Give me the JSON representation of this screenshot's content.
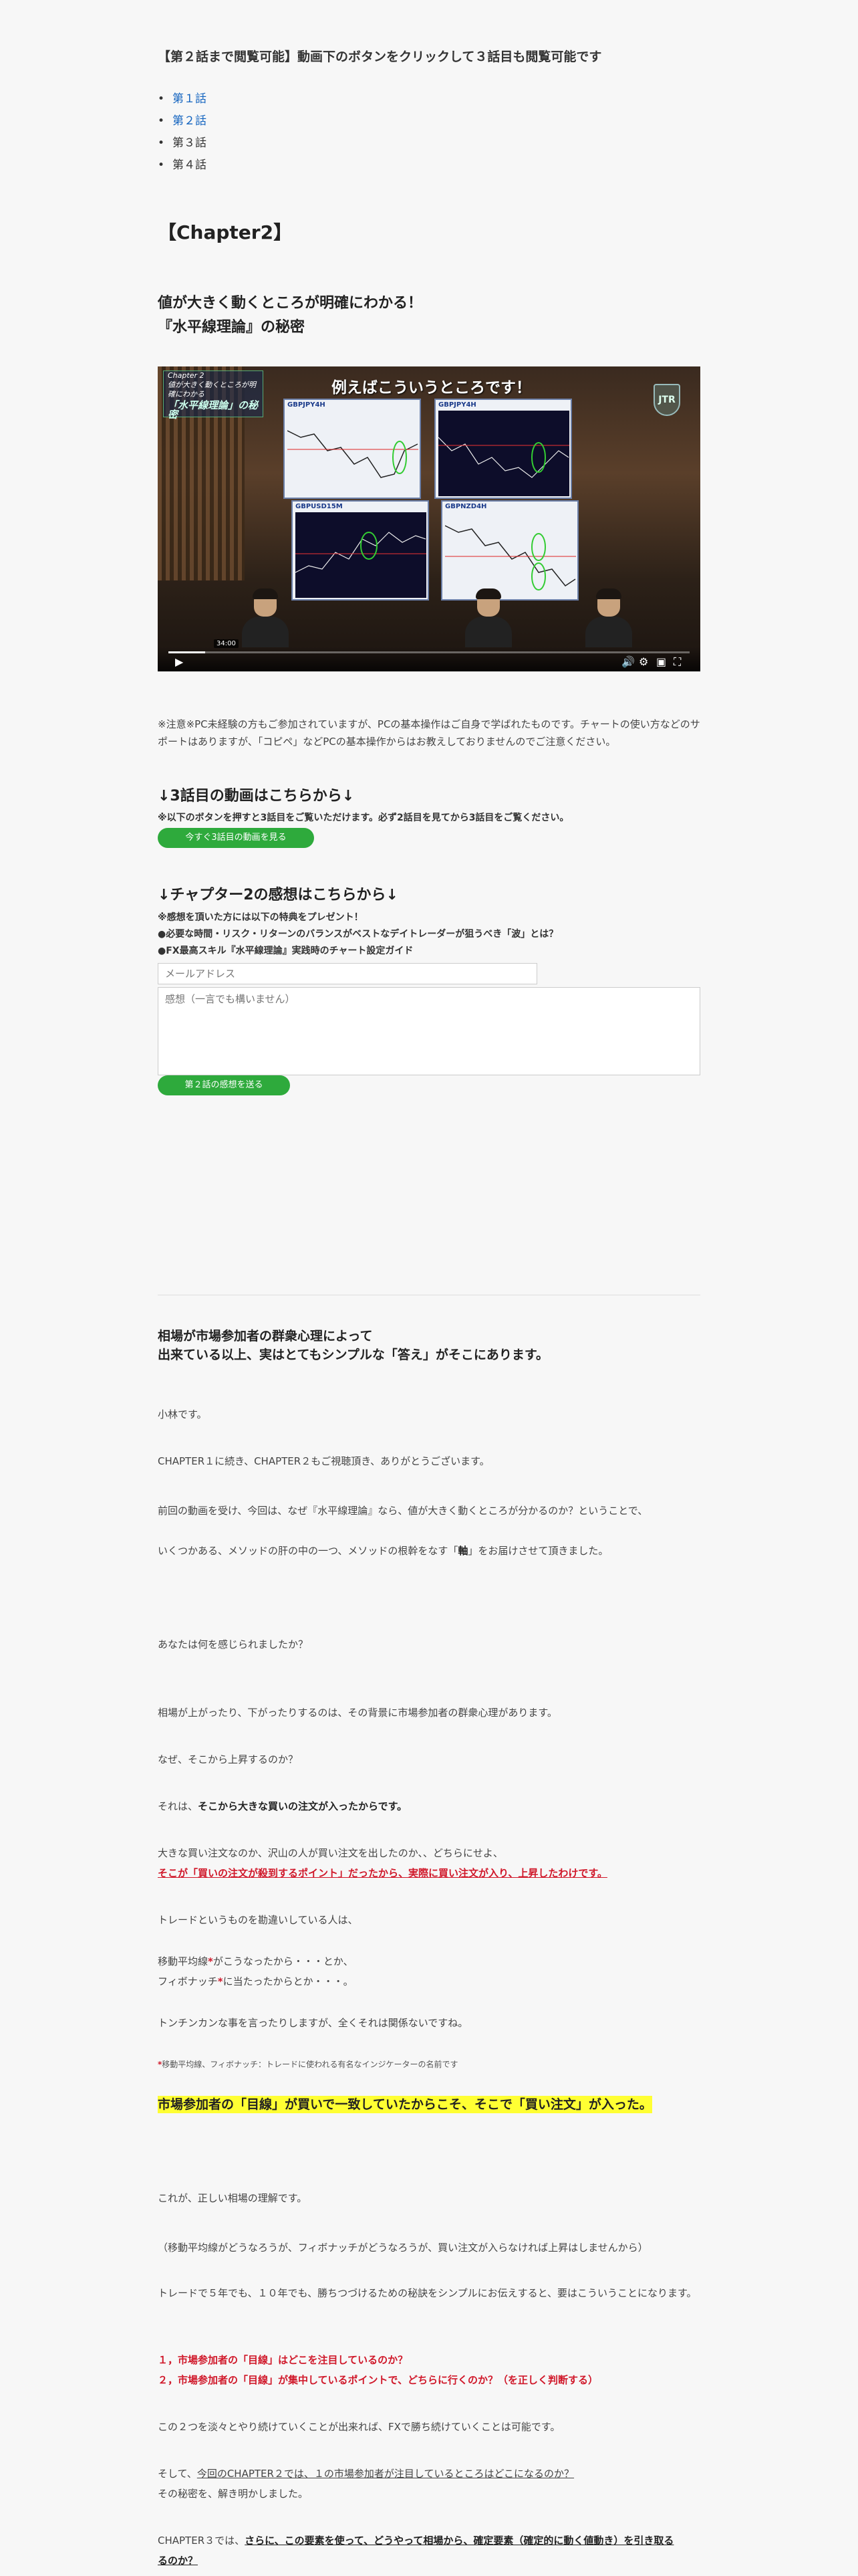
{
  "intro": "【第２話まで閲覧可能】動画下のボタンをクリックして３話目も閲覧可能です",
  "episodes": [
    {
      "label": "第１話",
      "link": true
    },
    {
      "label": "第２話",
      "link": true
    },
    {
      "label": "第３話",
      "link": false
    },
    {
      "label": "第４話",
      "link": false
    }
  ],
  "chapter_title": "【Chapter2】",
  "subtitle_line1": "値が大きく動くところが明確にわかる！",
  "subtitle_line2": "『水平線理論』の秘密",
  "video": {
    "overlay_title_small1": "Chapter 2",
    "overlay_title_small2": "値が大きく動くところが明確にわかる",
    "overlay_title_big": "「水平線理論」の秘密",
    "heading": "例えばこういうところです！",
    "logo": "JTR",
    "panels": [
      "GBPJPY4H",
      "GBPJPY4H",
      "GBPUSD15M",
      "GBPNZD4H"
    ],
    "time_badge": "34:00",
    "progress": 0.07
  },
  "note": "※注意※PC未経験の方もご参加されていますが、PCの基本操作はご自身で学ばれたものです。チャートの使い方などのサポートはありますが、「コピペ」などPCの基本操作からはお教えしておりませんのでご注意ください。",
  "section3": {
    "heading": "↓3話目の動画はこちらから↓",
    "instruction": "※以下のボタンを押すと3話目をご覧いただけます。必ず2話目を見てから3話目をご覧ください。",
    "button": "今すぐ3話目の動画を見る"
  },
  "feedback": {
    "heading": "↓チャプター2の感想はこちらから↓",
    "line1": "※感想を頂いた方には以下の特典をプレゼント！",
    "line2": "●必要な時間・リスク・リターンのバランスがベストなデイトレーダーが狙うべき「波」とは？",
    "line3": "●FX最高スキル『水平線理論』実践時のチャート設定ガイド",
    "email_placeholder": "メールアドレス",
    "comment_placeholder": "感想（一言でも構いません）",
    "submit": "第２話の感想を送る"
  },
  "article": {
    "lead1": "相場が市場参加者の群衆心理によって",
    "lead2": "出来ている以上、実はとてもシンプルな「答え」がそこにあります。",
    "p1": "小林です。",
    "p2": "CHAPTER１に続き、CHAPTER２もご視聴頂き、ありがとうございます。",
    "p3": "前回の動画を受け、今回は、なぜ『水平線理論』なら、値が大きく動くところが分かるのか？ということで、",
    "p4a": "いくつかある、メソッドの肝の中の一つ、メソッドの根幹をなす「",
    "p4b": "軸",
    "p4c": "」をお届けさせて頂きました。",
    "p5": "あなたは何を感じられましたか？",
    "p6": "相場が上がったり、下がったりするのは、その背景に市場参加者の群衆心理があります。",
    "p7": "なぜ、そこから上昇するのか？",
    "p8a": "それは、",
    "p8b": "そこから大きな買いの注文が入ったからです。",
    "p9": "大きな買い注文なのか、沢山の人が買い注文を出したのか、、どちらにせよ、",
    "p10": "そこが「買いの注文が殺到するポイント」だったから、実際に買い注文が入り、上昇したわけです。",
    "p11": "トレードというものを勘違いしている人は、",
    "p12a": "移動平均線",
    "p12b": "*",
    "p12c": "がこうなったから・・・とか、",
    "p13a": "フィボナッチ",
    "p13b": "*",
    "p13c": "に当たったからとか・・・。",
    "p14": "トンチンカンな事を言ったりしますが、全くそれは関係ないですね。",
    "p15a": "*",
    "p15b": "移動平均線、フィボナッチ：トレードに使われる有名なインジケーターの名前です",
    "p16": "市場参加者の「目線」が買いで一致していたからこそ、そこで「買い注文」が入った。",
    "p17": "これが、正しい相場の理解です。",
    "p18": "（移動平均線がどうなろうが、フィボナッチがどうなろうが、買い注文が入らなければ上昇はしませんから）",
    "p19": "トレードで５年でも、１０年でも、勝ちつづけるための秘訣をシンプルにお伝えすると、要はこういうことになります。",
    "p20": "１，市場参加者の「目線」はどこを注目しているのか？",
    "p21": "２，市場参加者の「目線」が集中しているポイントで、どちらに行くのか？（を正しく判断する）",
    "p22": "この２つを淡々とやり続けていくことが出来れば、FXで勝ち続けていくことは可能です。",
    "p23a": "そして、",
    "p23b": "今回のCHAPTER２では、１の市場参加者が注目しているところはどこになるのか？",
    "p24": "その秘密を、解き明かしました。",
    "p25a": "CHAPTER３では、",
    "p25b": "さらに、この要素を使って、どうやって相場から、確定要素（確定的に動く値動き）を引き取る",
    "p26": "るのか？"
  },
  "colors": {
    "link": "#1565c0",
    "button": "#2eaa3c",
    "red": "#d0182a",
    "highlight": "#ffff33"
  }
}
